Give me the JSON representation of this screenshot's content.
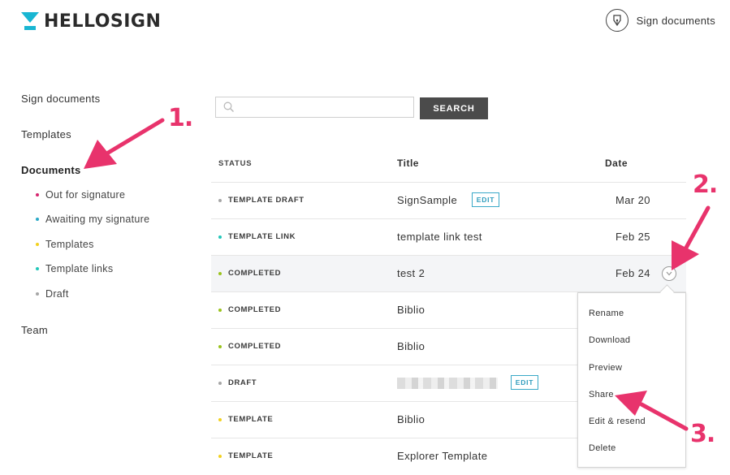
{
  "header": {
    "logo_text": "HELLOSIGN",
    "action_label": "Sign documents",
    "logo_color": "#19b6d2"
  },
  "sidebar": {
    "items": [
      {
        "label": "Sign documents"
      },
      {
        "label": "Templates"
      },
      {
        "label": "Documents"
      },
      {
        "label": "Team"
      }
    ],
    "sub_items": [
      {
        "label": "Out for signature",
        "color": "#d6266f"
      },
      {
        "label": "Awaiting my signature",
        "color": "#2aa9c7"
      },
      {
        "label": "Templates",
        "color": "#f2d11f"
      },
      {
        "label": "Template links",
        "color": "#22c7b9"
      },
      {
        "label": "Draft",
        "color": "#a6a6a6"
      }
    ]
  },
  "search": {
    "placeholder": "",
    "value": "",
    "button_label": "SEARCH"
  },
  "table": {
    "headers": {
      "status": "STATUS",
      "title": "Title",
      "date": "Date"
    },
    "rows": [
      {
        "status": "TEMPLATE DRAFT",
        "status_color": "#a6a6a6",
        "title": "SignSample",
        "date": "Mar 20",
        "edit": "EDIT"
      },
      {
        "status": "TEMPLATE LINK",
        "status_color": "#22c7b9",
        "title": "template link test",
        "date": "Feb 25"
      },
      {
        "status": "COMPLETED",
        "status_color": "#9ac31c",
        "title": "test 2",
        "date": "Feb 24"
      },
      {
        "status": "COMPLETED",
        "status_color": "#9ac31c",
        "title": "Biblio",
        "date": ""
      },
      {
        "status": "COMPLETED",
        "status_color": "#9ac31c",
        "title": "Biblio",
        "date": ""
      },
      {
        "status": "DRAFT",
        "status_color": "#a6a6a6",
        "title": "",
        "date": "",
        "edit": "EDIT"
      },
      {
        "status": "TEMPLATE",
        "status_color": "#f2d11f",
        "title": "Biblio",
        "date": ""
      },
      {
        "status": "TEMPLATE",
        "status_color": "#f2d11f",
        "title": "Explorer Template",
        "date": ""
      }
    ]
  },
  "row_menu": {
    "items": [
      {
        "label": "Rename"
      },
      {
        "label": "Download"
      },
      {
        "label": "Preview"
      },
      {
        "label": "Share"
      },
      {
        "label": "Edit & resend"
      },
      {
        "label": "Delete"
      }
    ]
  },
  "annotations": {
    "numbers": [
      "1.",
      "2.",
      "3."
    ],
    "color": "#e8336c"
  }
}
